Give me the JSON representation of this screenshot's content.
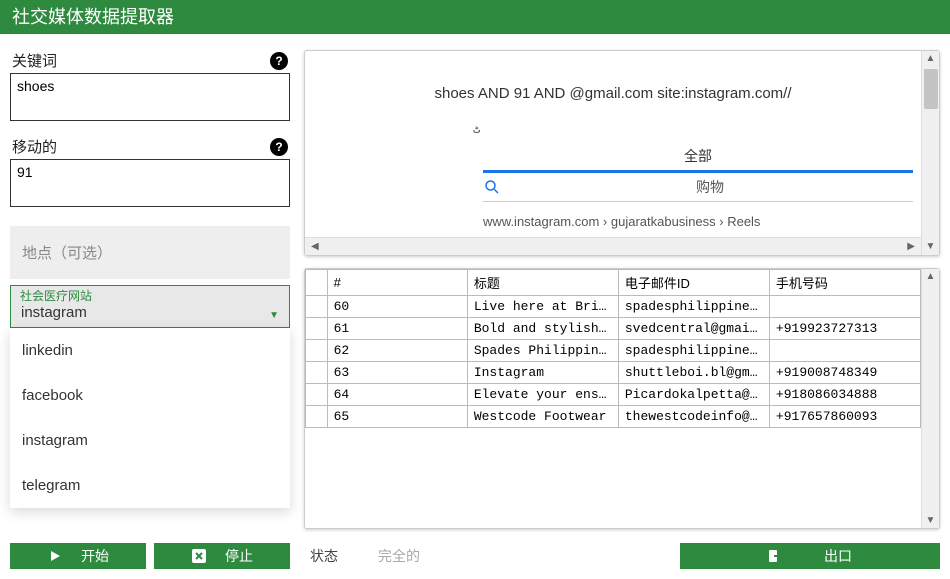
{
  "app_title": "社交媒体数据提取器",
  "left_panel": {
    "keyword_label": "关键词",
    "keyword_value": "shoes",
    "mobile_label": "移动的",
    "mobile_value": "91",
    "location_label": "地点（可选）",
    "dropdown_floating": "社会医疗网站",
    "dropdown_value": "instagram",
    "dropdown_items": [
      "linkedin",
      "facebook",
      "instagram",
      "telegram"
    ],
    "start_button": "开始",
    "stop_button": "停止"
  },
  "preview": {
    "query_text": "shoes AND 91 AND @gmail.com site:instagram.com//",
    "curly": "ٹ",
    "tab_all": "全部",
    "tab_shopping": "购物",
    "url_line": "www.instagram.com › gujaratkabusiness › Reels"
  },
  "table": {
    "headers": {
      "num": "#",
      "title": "标题",
      "email": "电子邮件ID",
      "phone": "手机号码"
    },
    "rows": [
      {
        "num": "60",
        "title": "Live here at Bridg...",
        "email": "spadesphilippines@...",
        "phone": ""
      },
      {
        "num": "61",
        "title": "Bold and stylish, ...",
        "email": "svedcentral@gmail.com",
        "phone": "+919923727313"
      },
      {
        "num": "62",
        "title": "Spades Philippines",
        "email": "spadesphilippines@...",
        "phone": ""
      },
      {
        "num": "63",
        "title": "Instagram",
        "email": "shuttleboi.bl@gmai...",
        "phone": "+919008748349"
      },
      {
        "num": "64",
        "title": "Elevate your ensem...",
        "email": "Picardokalpetta@gm...",
        "phone": "+918086034888"
      },
      {
        "num": "65",
        "title": "Westcode Footwear",
        "email": "thewestcodeinfo@gm...",
        "phone": "+917657860093"
      }
    ]
  },
  "footer": {
    "state_label": "状态",
    "state_value": "完全的",
    "export_button": "出口"
  }
}
